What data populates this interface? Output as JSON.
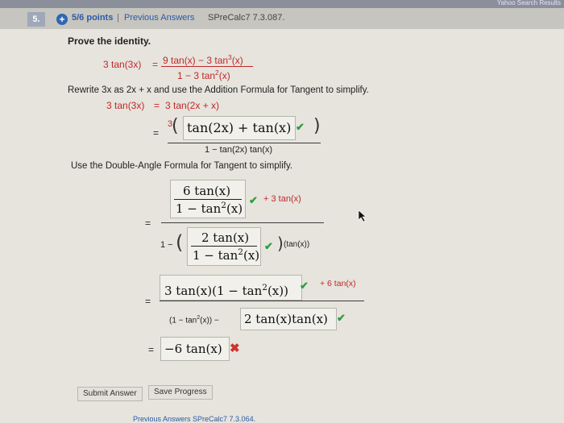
{
  "header": {
    "topstrip_text": "Yahoo Search Results",
    "question_number": "5.",
    "points": "5/6 points",
    "separator": "|",
    "previous_answers": "Previous Answers",
    "source": "SPreCalc7 7.3.087."
  },
  "problem": {
    "prompt": "Prove the identity.",
    "identity_left": "3 tan(3x)",
    "identity_eq": "=",
    "identity_num": "9 tan(x) − 3 tan",
    "identity_num_exp": "3",
    "identity_num_tail": "(x)",
    "identity_den": "1 − 3 tan",
    "identity_den_exp": "2",
    "identity_den_tail": "(x)"
  },
  "step1": {
    "instruction": "Rewrite 3x as 2x + x and use the Addition Formula for Tangent to simplify.",
    "line1_left": "3 tan(3x)",
    "line1_eq": "=",
    "line1_right": "3 tan(2x + x)",
    "line2_eq": "=",
    "line2_coef": "3",
    "answer_box": "tan(2x) + tan(x)",
    "line2_den": "1 − tan(2x) tan(x)"
  },
  "step2": {
    "instruction": "Use the Double-Angle Formula for Tangent to simplify.",
    "eq": "=",
    "box1_num": "6 tan(x)",
    "box1_den": "1 − tan",
    "box1_den_exp": "2",
    "box1_den_tail": "(x)",
    "term1_tail": "+ 3 tan(x)",
    "den_prefix": "1 −",
    "box2_num": "2 tan(x)",
    "box2_den": "1 − tan",
    "box2_den_exp": "2",
    "box2_den_tail": "(x)",
    "term2_tail": "(tan(x))"
  },
  "step3": {
    "eq": "=",
    "box_num": "3 tan(x)(1 − tan",
    "box_num_exp": "2",
    "box_num_tail": "(x))",
    "num_tail": "+ 6 tan(x)",
    "den_left": "(1 − tan",
    "den_left_exp": "2",
    "den_left_tail": "(x)) −",
    "box_den": "2 tan(x)tan(x)"
  },
  "step4": {
    "eq": "=",
    "box": "−6 tan(x)"
  },
  "buttons": {
    "submit": "Submit Answer",
    "save": "Save Progress"
  },
  "footer": {
    "bottom_text": "Previous Answers  SPreCalc7 7.3.064."
  },
  "colors": {
    "correct": "#2f9e3f",
    "incorrect": "#d0322c",
    "expression": "#c2282a",
    "link": "#2c5aa5"
  }
}
